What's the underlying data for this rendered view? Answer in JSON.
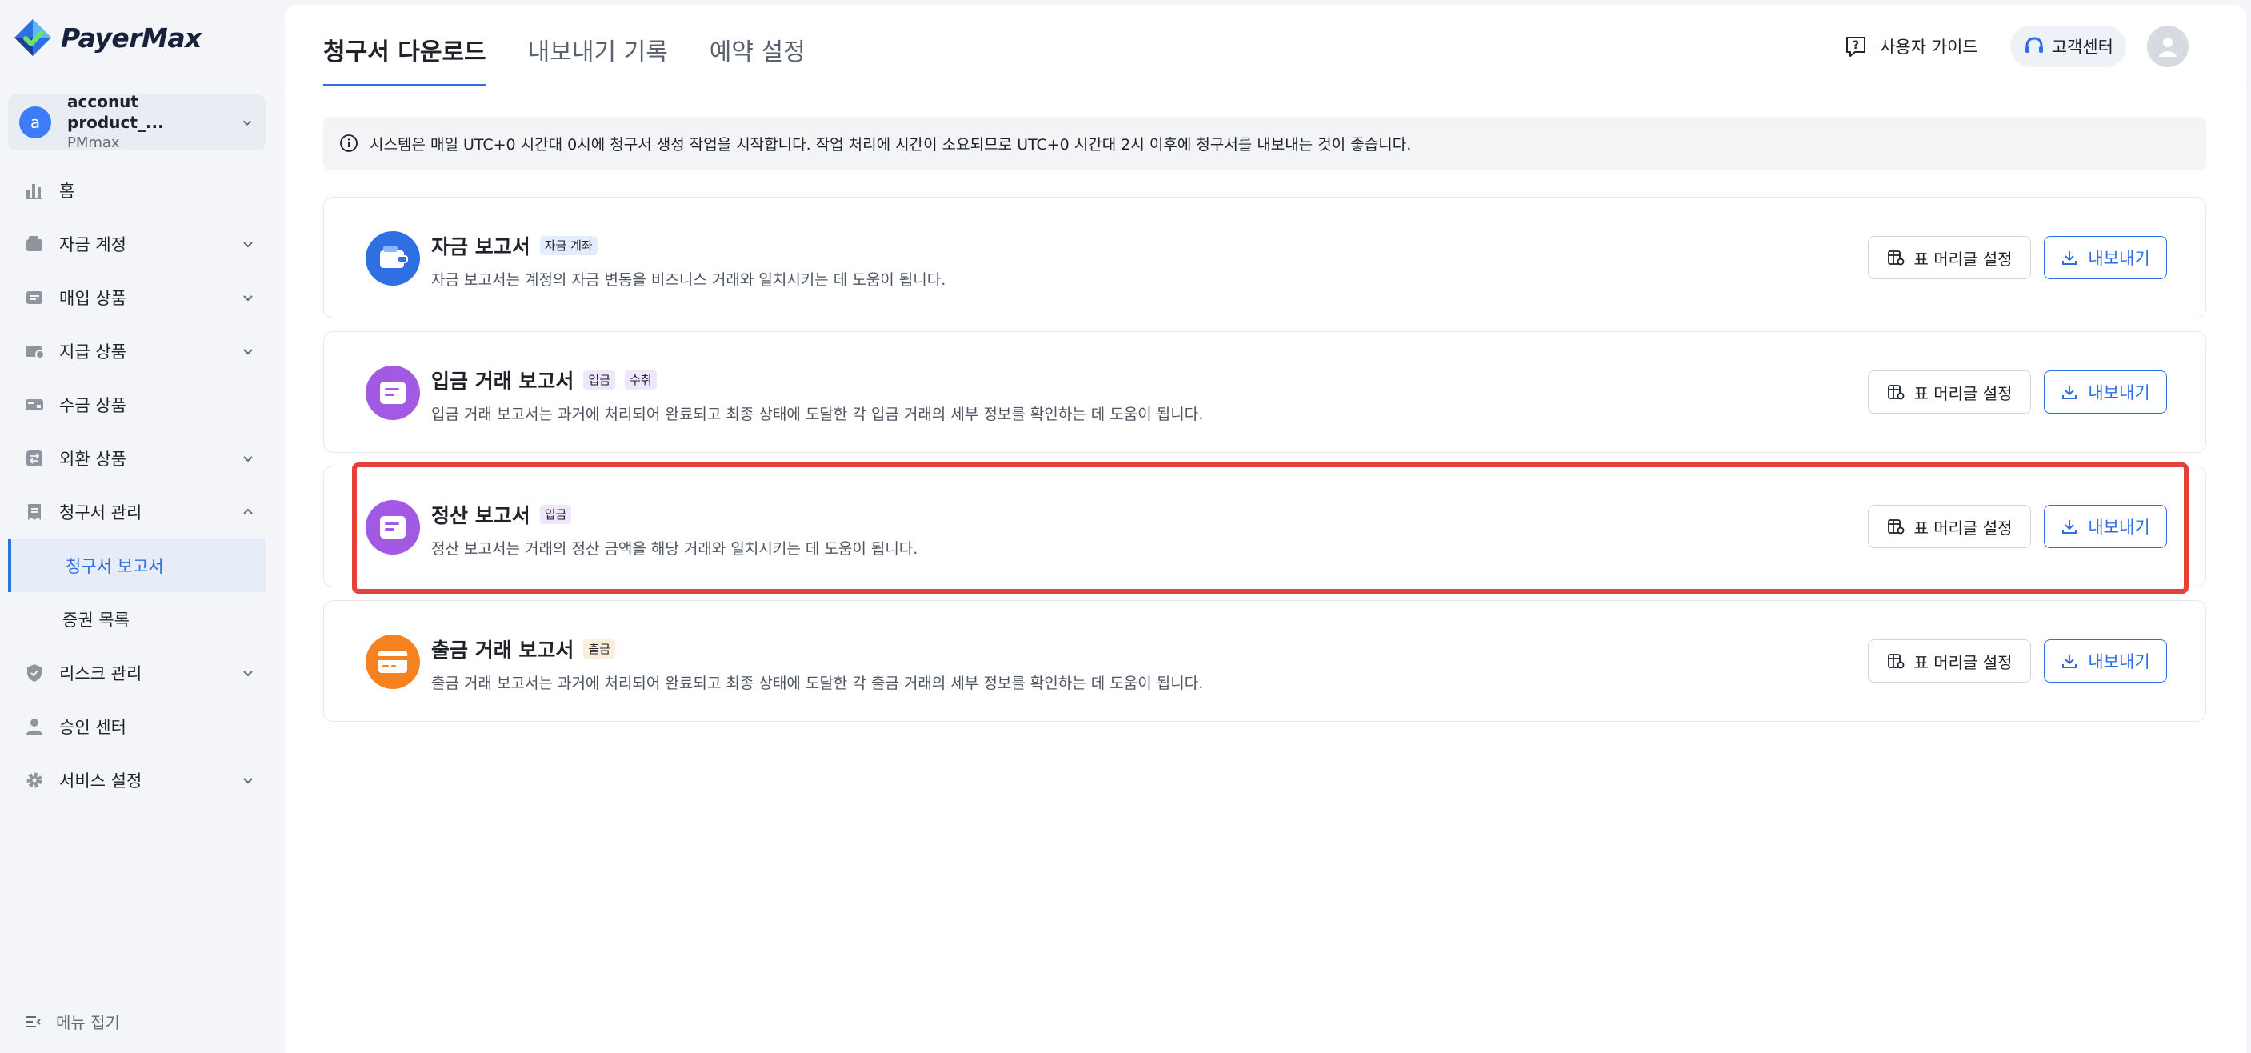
{
  "brand": {
    "name": "PayerMax",
    "primary_color": "#2f6fe4",
    "highlight_color": "#e5403a"
  },
  "account": {
    "avatar_letter": "a",
    "name": "acconut product_...",
    "org": "PMmax"
  },
  "sidebar": {
    "items": [
      {
        "label": "홈",
        "icon": "bar-chart-icon",
        "has_chevron": false
      },
      {
        "label": "자금 계정",
        "icon": "wallet-icon",
        "has_chevron": true
      },
      {
        "label": "매입 상품",
        "icon": "card-icon",
        "has_chevron": true
      },
      {
        "label": "지급 상품",
        "icon": "payout-icon",
        "has_chevron": true
      },
      {
        "label": "수금 상품",
        "icon": "collect-icon",
        "has_chevron": false
      },
      {
        "label": "외환 상품",
        "icon": "exchange-icon",
        "has_chevron": true
      },
      {
        "label": "청구서 관리",
        "icon": "bill-icon",
        "has_chevron": true,
        "expanded": true
      }
    ],
    "sub_items": [
      {
        "label": "청구서 보고서",
        "active": true
      },
      {
        "label": "증권 목록",
        "active": false
      }
    ],
    "items_after": [
      {
        "label": "리스크 관리",
        "icon": "shield-icon",
        "has_chevron": true
      },
      {
        "label": "승인 센터",
        "icon": "user-icon",
        "has_chevron": false
      },
      {
        "label": "서비스 설정",
        "icon": "gear-icon",
        "has_chevron": true
      }
    ],
    "collapse_label": "메뉴 접기"
  },
  "header": {
    "tabs": [
      {
        "label": "청구서 다운로드",
        "active": true
      },
      {
        "label": "내보내기 기록",
        "active": false
      },
      {
        "label": "예약 설정",
        "active": false
      }
    ],
    "guide_label": "사용자 가이드",
    "support_label": "고객센터"
  },
  "notice": "시스템은 매일 UTC+0 시간대 0시에 청구서 생성 작업을 시작합니다. 작업 처리에 시간이 소요되므로 UTC+0 시간대 2시 이후에 청구서를 내보내는 것이 좋습니다.",
  "reports": [
    {
      "title": "자금 보고서",
      "tags": [
        {
          "label": "자금 계좌",
          "color": "blue"
        }
      ],
      "description": "자금 보고서는 계정의 자금 변동을 비즈니스 거래와 일치시키는 데 도움이 됩니다.",
      "icon": "wallet-icon",
      "icon_color": "#2f6fe4"
    },
    {
      "title": "입금 거래 보고서",
      "tags": [
        {
          "label": "입금",
          "color": "purple"
        },
        {
          "label": "수취",
          "color": "purple"
        }
      ],
      "description": "입금 거래 보고서는 과거에 처리되어 완료되고 최종 상태에 도달한 각 입금 거래의 세부 정보를 확인하는 데 도움이 됩니다.",
      "icon": "document-icon",
      "icon_color": "#a25ae4"
    },
    {
      "title": "정산 보고서",
      "tags": [
        {
          "label": "입금",
          "color": "purple"
        }
      ],
      "description": "정산 보고서는 거래의 정산 금액을 해당 거래와 일치시키는 데 도움이 됩니다.",
      "icon": "document-icon",
      "icon_color": "#a25ae4"
    },
    {
      "title": "출금 거래 보고서",
      "tags": [
        {
          "label": "출금",
          "color": "orange"
        }
      ],
      "description": "출금 거래 보고서는 과거에 처리되어 완료되고 최종 상태에 도달한 각 출금 거래의 세부 정보를 확인하는 데 도움이 됩니다.",
      "icon": "card-icon",
      "icon_color": "#f5821f"
    }
  ],
  "buttons": {
    "header_settings": "표 머리글 설정",
    "export": "내보내기"
  }
}
